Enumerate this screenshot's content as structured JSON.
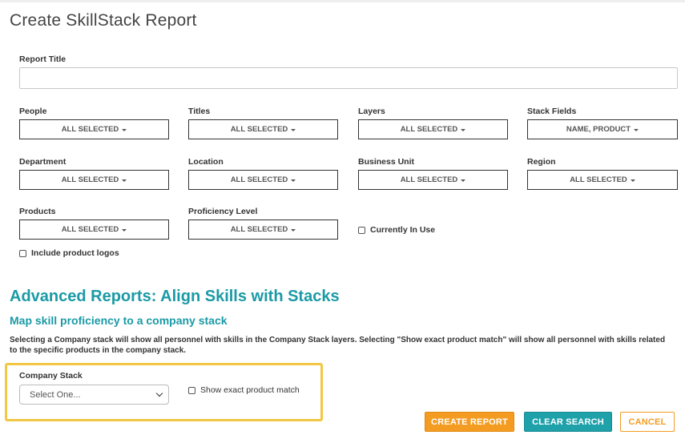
{
  "page": {
    "title": "Create SkillStack Report"
  },
  "report_title": {
    "label": "Report Title",
    "value": "",
    "placeholder": ""
  },
  "filters": {
    "people": {
      "label": "People",
      "value": "ALL SELECTED"
    },
    "titles": {
      "label": "Titles",
      "value": "ALL SELECTED"
    },
    "layers": {
      "label": "Layers",
      "value": "ALL SELECTED"
    },
    "stack_fields": {
      "label": "Stack Fields",
      "value": "NAME, PRODUCT"
    },
    "department": {
      "label": "Department",
      "value": "ALL SELECTED"
    },
    "location": {
      "label": "Location",
      "value": "ALL SELECTED"
    },
    "business_unit": {
      "label": "Business Unit",
      "value": "ALL SELECTED"
    },
    "region": {
      "label": "Region",
      "value": "ALL SELECTED"
    },
    "products": {
      "label": "Products",
      "value": "ALL SELECTED"
    },
    "proficiency_level": {
      "label": "Proficiency Level",
      "value": "ALL SELECTED"
    }
  },
  "options": {
    "currently_in_use": {
      "label": "Currently In Use",
      "checked": false
    },
    "include_product_logos": {
      "label": "Include product logos",
      "checked": false
    }
  },
  "advanced": {
    "title": "Advanced Reports: Align Skills with Stacks",
    "subtitle": "Map skill proficiency to a company stack",
    "description": "Selecting a Company stack will show all personnel with skills in the Company Stack layers. Selecting \"Show exact product match\" will show all personnel with skills related to the specific products in the company stack.",
    "company_stack": {
      "label": "Company Stack",
      "value": "Select One..."
    },
    "exact_match": {
      "label": "Show exact product match",
      "checked": false
    },
    "highlight_color": "#f2c744"
  },
  "buttons": {
    "create": "CREATE REPORT",
    "clear": "CLEAR SEARCH",
    "cancel": "CANCEL"
  },
  "colors": {
    "accent_teal": "#1a9aa6",
    "accent_orange": "#f39c21"
  }
}
